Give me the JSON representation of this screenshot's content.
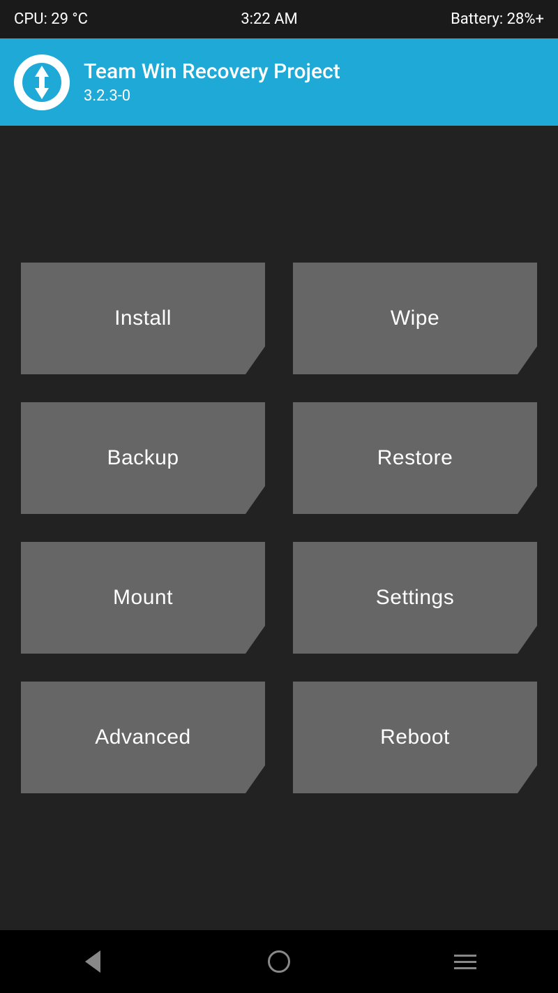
{
  "status_bar": {
    "cpu": "CPU: 29 °C",
    "time": "3:22 AM",
    "battery": "Battery: 28%+"
  },
  "header": {
    "title": "Team Win Recovery Project",
    "version": "3.2.3-0",
    "logo_alt": "TWRP Logo"
  },
  "buttons": [
    {
      "id": "install",
      "label": "Install"
    },
    {
      "id": "wipe",
      "label": "Wipe"
    },
    {
      "id": "backup",
      "label": "Backup"
    },
    {
      "id": "restore",
      "label": "Restore"
    },
    {
      "id": "mount",
      "label": "Mount"
    },
    {
      "id": "settings",
      "label": "Settings"
    },
    {
      "id": "advanced",
      "label": "Advanced"
    },
    {
      "id": "reboot",
      "label": "Reboot"
    }
  ],
  "nav": {
    "back_label": "Back",
    "home_label": "Home",
    "menu_label": "Menu"
  }
}
